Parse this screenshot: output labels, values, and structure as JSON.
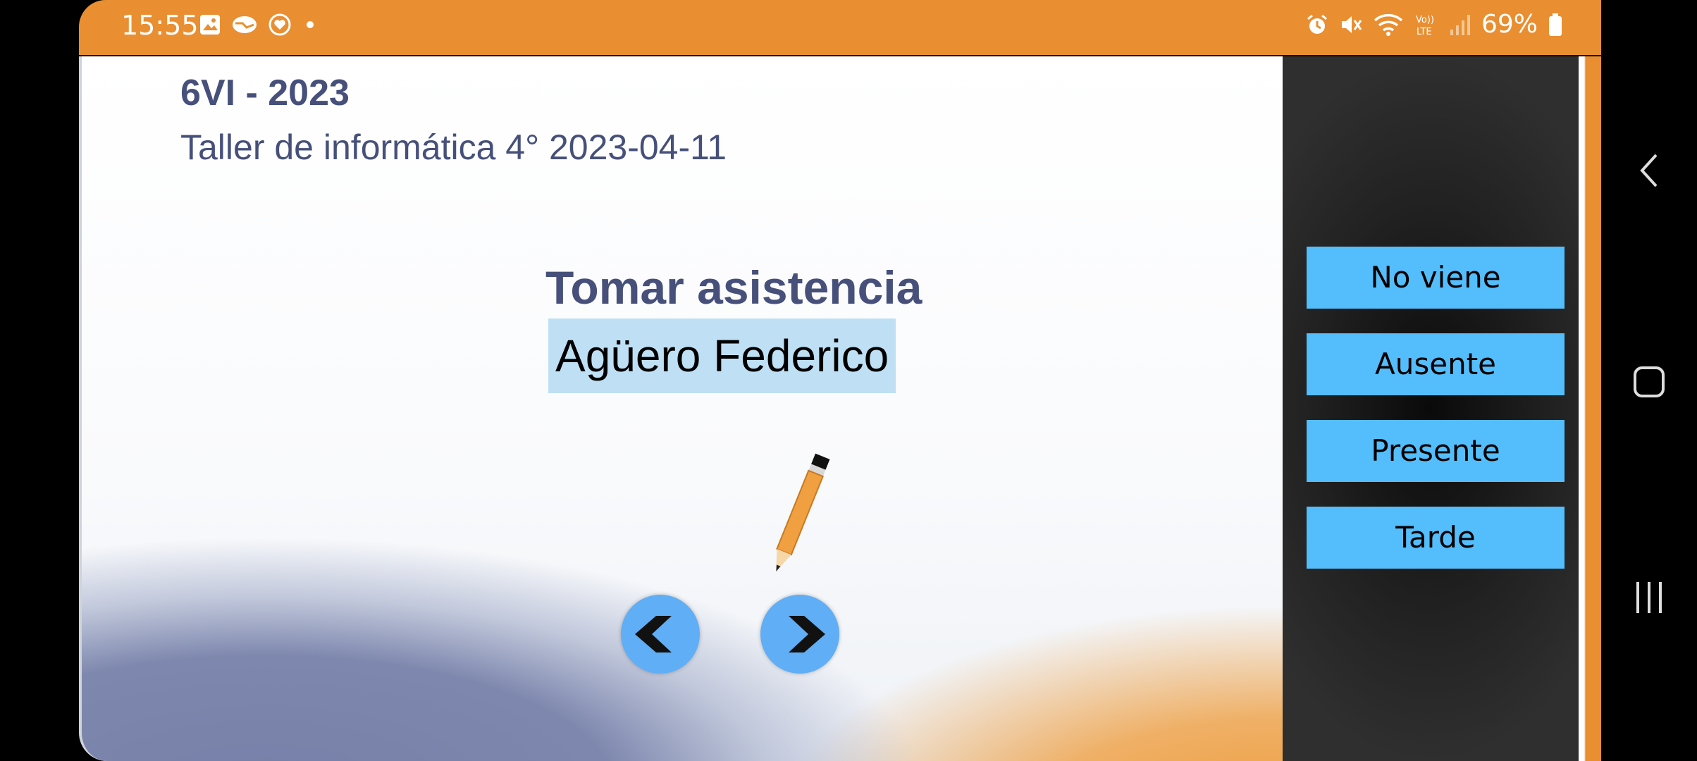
{
  "status_bar": {
    "time": "15:55",
    "battery": "69%",
    "left_icons": [
      "gallery-icon",
      "handshake-icon",
      "heart-shield-icon",
      "dot-icon"
    ],
    "right_icons": [
      "alarm-icon",
      "mute-icon",
      "wifi-icon",
      "volte-icon",
      "signal-icon",
      "battery-icon"
    ]
  },
  "header": {
    "course": "6VI - 2023",
    "subject": "Taller de informática 4° 2023-04-11"
  },
  "main": {
    "heading": "Tomar asistencia",
    "student_name": "Agüero Federico"
  },
  "attendance_options": [
    "No viene",
    "Ausente",
    "Presente",
    "Tarde"
  ],
  "colors": {
    "status_bar": "#e98f31",
    "title_text": "#46507a",
    "option_button": "#54bdfb",
    "nav_button": "#60aef5",
    "name_highlight": "#bfe0f4"
  },
  "system_nav": [
    "back-icon",
    "home-icon",
    "recents-icon"
  ]
}
